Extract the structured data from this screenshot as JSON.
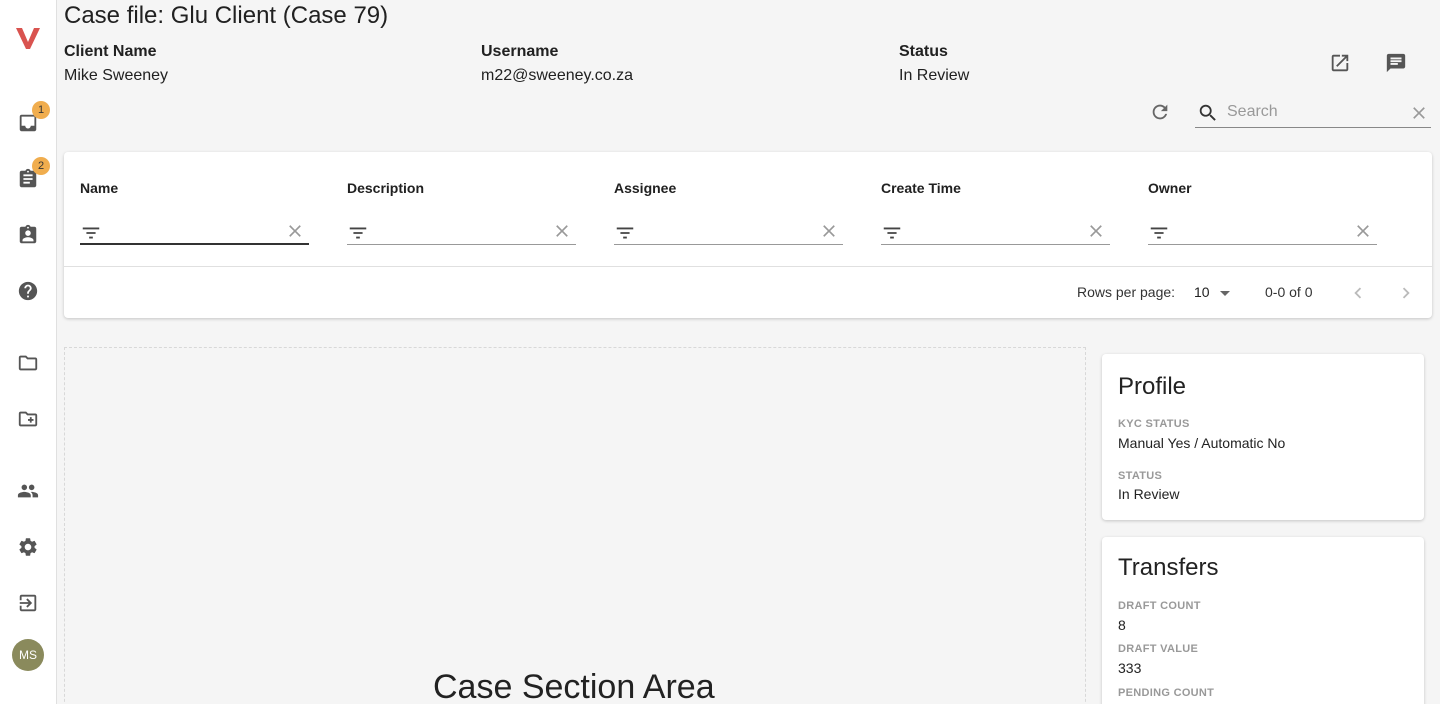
{
  "app": {
    "logo_letter": "V",
    "accent_color": "#d9534f",
    "badge_color": "#f0ad4e"
  },
  "sidebar": {
    "items": [
      {
        "name": "inbox",
        "icon": "inbox-icon",
        "badge": "1"
      },
      {
        "name": "tasks",
        "icon": "assignment-icon",
        "badge": "2"
      },
      {
        "name": "assigned",
        "icon": "assignment-ind-icon"
      },
      {
        "name": "help",
        "icon": "help-icon"
      },
      {
        "name": "folder",
        "icon": "folder-icon"
      },
      {
        "name": "new-folder",
        "icon": "create-new-folder-icon"
      },
      {
        "name": "users",
        "icon": "people-icon"
      },
      {
        "name": "settings",
        "icon": "settings-icon"
      },
      {
        "name": "logout",
        "icon": "exit-icon"
      }
    ],
    "avatar_initials": "MS"
  },
  "header": {
    "title": "Case file: Glu Client (Case 79)",
    "client_name_label": "Client Name",
    "client_name": "Mike Sweeney",
    "username_label": "Username",
    "username": "m22@sweeney.co.za",
    "status_label": "Status",
    "status": "In Review"
  },
  "search": {
    "placeholder": "Search",
    "value": ""
  },
  "table": {
    "columns": [
      {
        "header": "Name"
      },
      {
        "header": "Description"
      },
      {
        "header": "Assignee"
      },
      {
        "header": "Create Time"
      },
      {
        "header": "Owner"
      }
    ],
    "rows": [],
    "rows_per_page_label": "Rows per page:",
    "rows_per_page": "10",
    "range": "0-0 of 0"
  },
  "case_area": {
    "label": "Case Section Area"
  },
  "profile": {
    "title": "Profile",
    "kyc_status_label": "KYC STATUS",
    "kyc_status": "Manual Yes / Automatic No",
    "status_label": "STATUS",
    "status": "In Review"
  },
  "transfers": {
    "title": "Transfers",
    "draft_count_label": "DRAFT COUNT",
    "draft_count": "8",
    "draft_value_label": "DRAFT VALUE",
    "draft_value": "333",
    "pending_count_label": "PENDING COUNT"
  }
}
